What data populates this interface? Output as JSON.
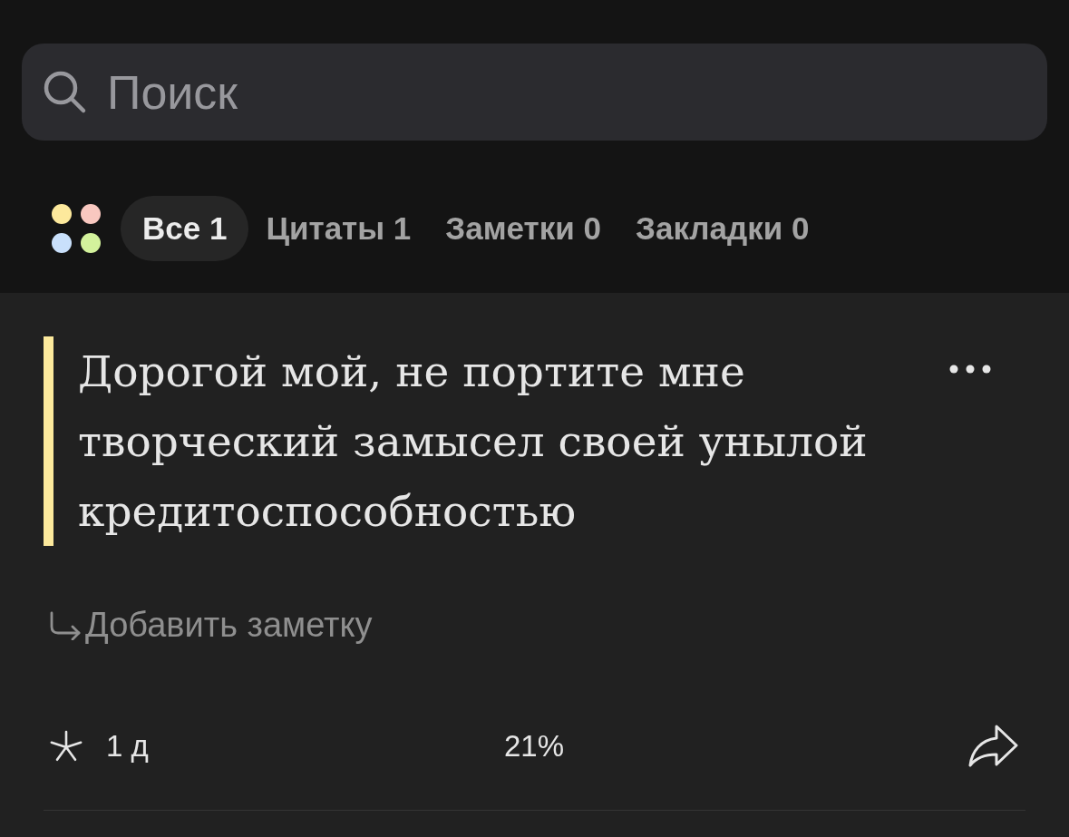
{
  "search": {
    "placeholder": "Поиск"
  },
  "filters": {
    "tabs": [
      {
        "label": "Все 1",
        "selected": true
      },
      {
        "label": "Цитаты 1",
        "selected": false
      },
      {
        "label": "Заметки 0",
        "selected": false
      },
      {
        "label": "Закладки 0",
        "selected": false
      }
    ]
  },
  "quotes": [
    {
      "text": "Дорогой мой, не портите мне творческий замысел своей унылой кредитоспособностью",
      "color": "#fce99c",
      "note_action": "Добавить заметку",
      "age": "1 д",
      "progress": "21%"
    }
  ]
}
